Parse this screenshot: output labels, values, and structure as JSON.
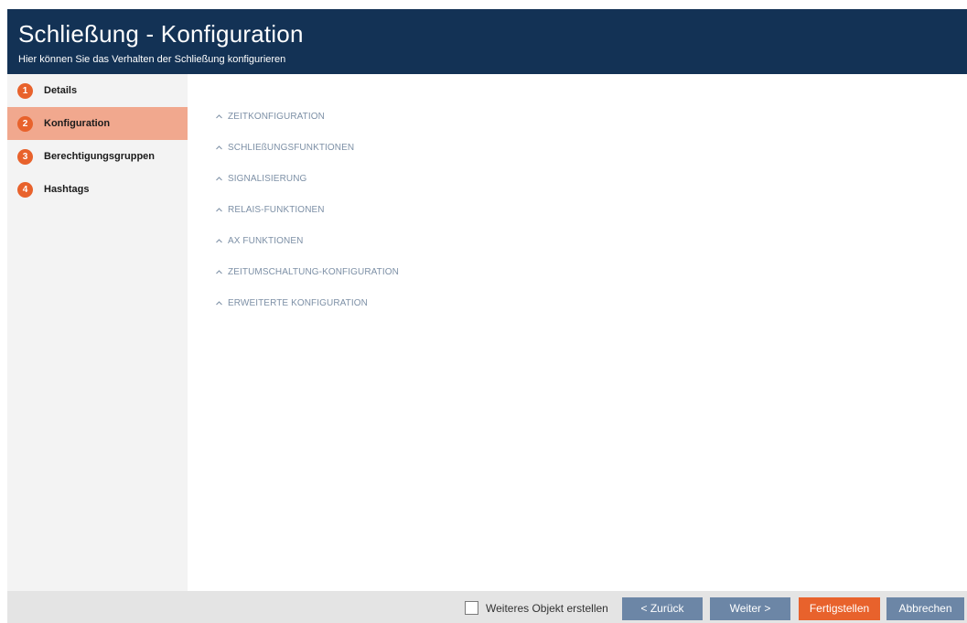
{
  "header": {
    "title": "Schließung - Konfiguration",
    "subtitle": "Hier können Sie das Verhalten der Schließung konfigurieren"
  },
  "steps": [
    {
      "number": "1",
      "label": "Details",
      "active": false
    },
    {
      "number": "2",
      "label": "Konfiguration",
      "active": true
    },
    {
      "number": "3",
      "label": "Berechtigungsgruppen",
      "active": false
    },
    {
      "number": "4",
      "label": "Hashtags",
      "active": false
    }
  ],
  "sections": [
    {
      "title": "ZEITKONFIGURATION",
      "icon": "chevron-up-icon"
    },
    {
      "title": "SCHLIEßUNGSFUNKTIONEN",
      "icon": "chevron-up-icon"
    },
    {
      "title": "SIGNALISIERUNG",
      "icon": "chevron-up-icon"
    },
    {
      "title": "RELAIS-FUNKTIONEN",
      "icon": "chevron-up-icon"
    },
    {
      "title": "AX FUNKTIONEN",
      "icon": "chevron-up-icon"
    },
    {
      "title": "ZEITUMSCHALTUNG-KONFIGURATION",
      "icon": "chevron-up-icon"
    },
    {
      "title": "ERWEITERTE KONFIGURATION",
      "icon": "chevron-up-icon"
    }
  ],
  "footer": {
    "create_another_label": "Weiteres Objekt erstellen",
    "create_another_checked": false,
    "back_label": "< Zurück",
    "next_label": "Weiter >",
    "finish_label": "Fertigstellen",
    "cancel_label": "Abbrechen"
  },
  "colors": {
    "header_bg": "#133255",
    "accent": "#e8622c",
    "active_step_bg": "#f1a88e",
    "button_secondary": "#6c86a6",
    "section_text": "#7d90a6"
  }
}
